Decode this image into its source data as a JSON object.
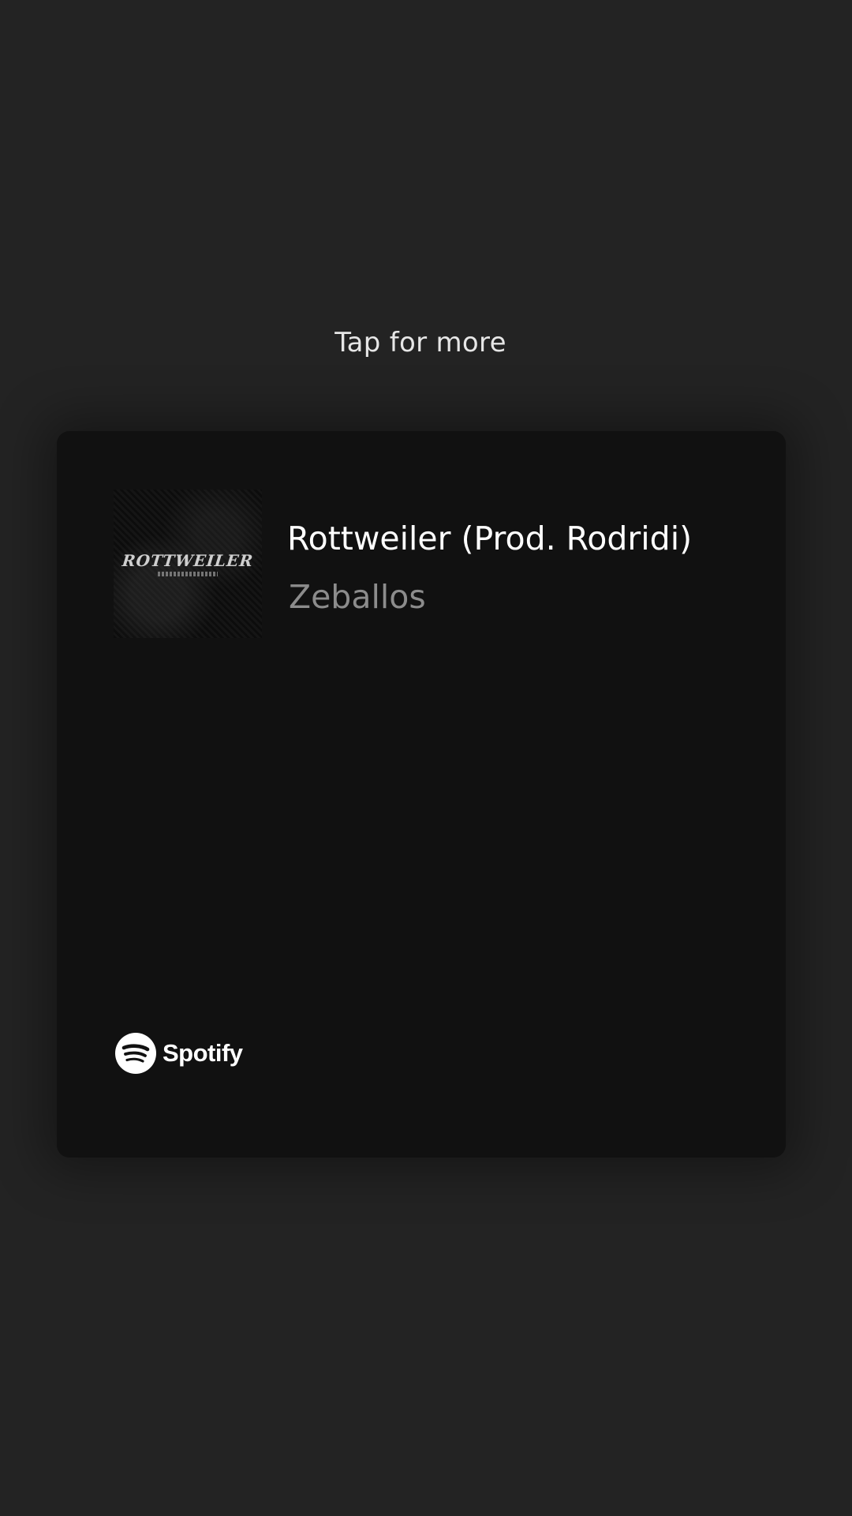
{
  "hint": "Tap for more",
  "track": {
    "title": "Rottweiler (Prod. Rodridi)",
    "artist": "Zeballos",
    "cover_text": "ROTTWEILER"
  },
  "brand": {
    "name": "Spotify",
    "icon": "spotify-logo-icon"
  },
  "colors": {
    "background": "#232323",
    "card": "#111111",
    "artist_text": "#8c8c8c"
  }
}
